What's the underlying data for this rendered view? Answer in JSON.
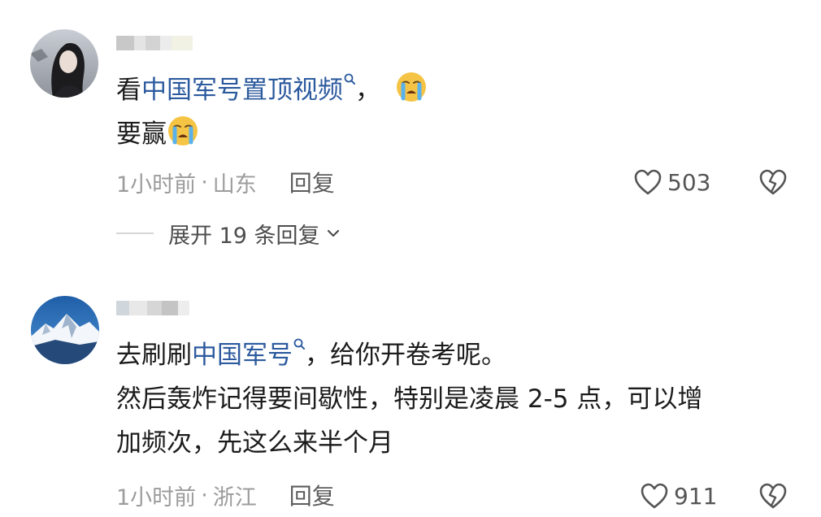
{
  "comments": [
    {
      "text_lines": [
        {
          "before": "看",
          "link": "中国军号置顶视频",
          "after": "，"
        },
        {
          "before": "要赢",
          "link": "",
          "after": ""
        }
      ],
      "time": "1小时前",
      "separator": "·",
      "location": "山东",
      "reply_label": "回复",
      "likes": "503",
      "expand_label": "展开 19 条回复"
    },
    {
      "text_lines": [
        {
          "before": "去刷刷",
          "link": "中国军号",
          "after": "，给你开卷考呢。"
        },
        {
          "before": "然后轰炸记得要间歇性，特别是凌晨 2-5 点，可以增",
          "link": "",
          "after": ""
        },
        {
          "before": "加频次，先这么来半个月",
          "link": "",
          "after": ""
        }
      ],
      "time": "1小时前",
      "separator": "·",
      "location": "浙江",
      "reply_label": "回复",
      "likes": "911"
    }
  ],
  "icons": {
    "like": "heart-outline-icon",
    "dislike": "broken-heart-icon",
    "expand": "chevron-down-icon",
    "search_link": "search-mark-icon",
    "emoji": "loudly-crying-face-emoji"
  },
  "colors": {
    "link": "#2c5a9e",
    "meta": "#9c9c9c",
    "text": "#1b1b1b"
  }
}
